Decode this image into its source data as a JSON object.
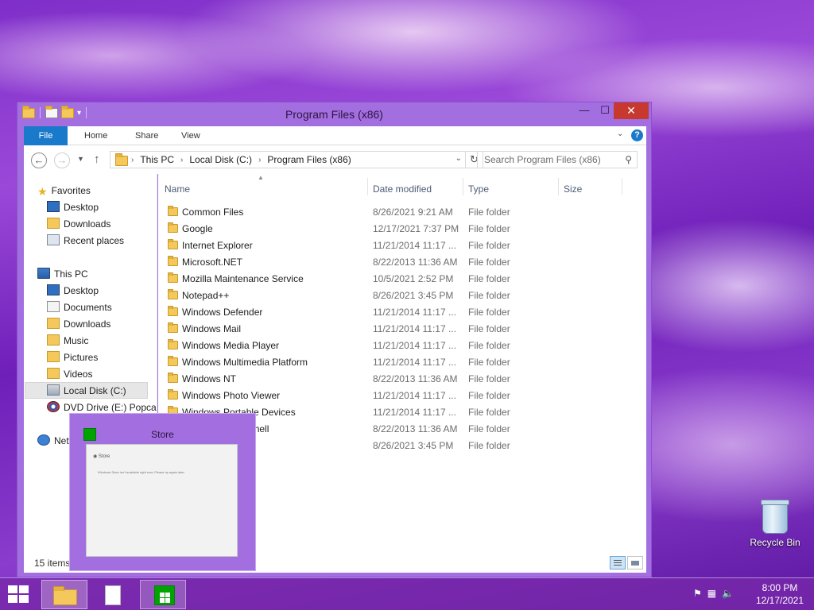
{
  "window": {
    "title": "Program Files (x86)",
    "controls": {
      "minimize": "—",
      "maximize": "☐",
      "close": "✕"
    }
  },
  "ribbon": {
    "tabs": [
      "File",
      "Home",
      "Share",
      "View"
    ],
    "help": "?"
  },
  "address": {
    "crumbs": [
      "This PC",
      "Local Disk (C:)",
      "Program Files (x86)"
    ],
    "search_placeholder": "Search Program Files (x86)"
  },
  "nav": {
    "favorites_label": "Favorites",
    "favorites": [
      "Desktop",
      "Downloads",
      "Recent places"
    ],
    "thispc_label": "This PC",
    "thispc_items": [
      "Desktop",
      "Documents",
      "Downloads",
      "Music",
      "Pictures",
      "Videos",
      "Local Disk (C:)",
      "DVD Drive (E:) Popca"
    ],
    "network_label": "Network",
    "selected": "Local Disk (C:)"
  },
  "columns": {
    "name": "Name",
    "date": "Date modified",
    "type": "Type",
    "size": "Size"
  },
  "files": [
    {
      "name": "Common Files",
      "date": "8/26/2021 9:21 AM",
      "type": "File folder"
    },
    {
      "name": "Google",
      "date": "12/17/2021 7:37 PM",
      "type": "File folder"
    },
    {
      "name": "Internet Explorer",
      "date": "11/21/2014 11:17 ...",
      "type": "File folder"
    },
    {
      "name": "Microsoft.NET",
      "date": "8/22/2013 11:36 AM",
      "type": "File folder"
    },
    {
      "name": "Mozilla Maintenance Service",
      "date": "10/5/2021 2:52 PM",
      "type": "File folder"
    },
    {
      "name": "Notepad++",
      "date": "8/26/2021 3:45 PM",
      "type": "File folder"
    },
    {
      "name": "Windows Defender",
      "date": "11/21/2014 11:17 ...",
      "type": "File folder"
    },
    {
      "name": "Windows Mail",
      "date": "11/21/2014 11:17 ...",
      "type": "File folder"
    },
    {
      "name": "Windows Media Player",
      "date": "11/21/2014 11:17 ...",
      "type": "File folder"
    },
    {
      "name": "Windows Multimedia Platform",
      "date": "11/21/2014 11:17 ...",
      "type": "File folder"
    },
    {
      "name": "Windows NT",
      "date": "8/22/2013 11:36 AM",
      "type": "File folder"
    },
    {
      "name": "Windows Photo Viewer",
      "date": "11/21/2014 11:17 ...",
      "type": "File folder"
    },
    {
      "name": "Windows Portable Devices",
      "date": "11/21/2014 11:17 ...",
      "type": "File folder"
    },
    {
      "name": "WindowsPowerShell",
      "date": "8/22/2013 11:36 AM",
      "type": "File folder"
    },
    {
      "name": "",
      "date": "8/26/2021 3:45 PM",
      "type": "File folder"
    }
  ],
  "status": {
    "count": "15 items"
  },
  "thumbnail": {
    "title": "Store",
    "preview_title": "Store",
    "preview_message": "Windows Store isn't available right now. Please try again later."
  },
  "desktop": {
    "recycle_bin": "Recycle Bin"
  },
  "taskbar": {
    "time": "8:00 PM",
    "date": "12/17/2021"
  },
  "colors": {
    "accent": "#1979ca",
    "window_frame": "#a36fe0",
    "close": "#c7382e",
    "store": "#00a300"
  }
}
